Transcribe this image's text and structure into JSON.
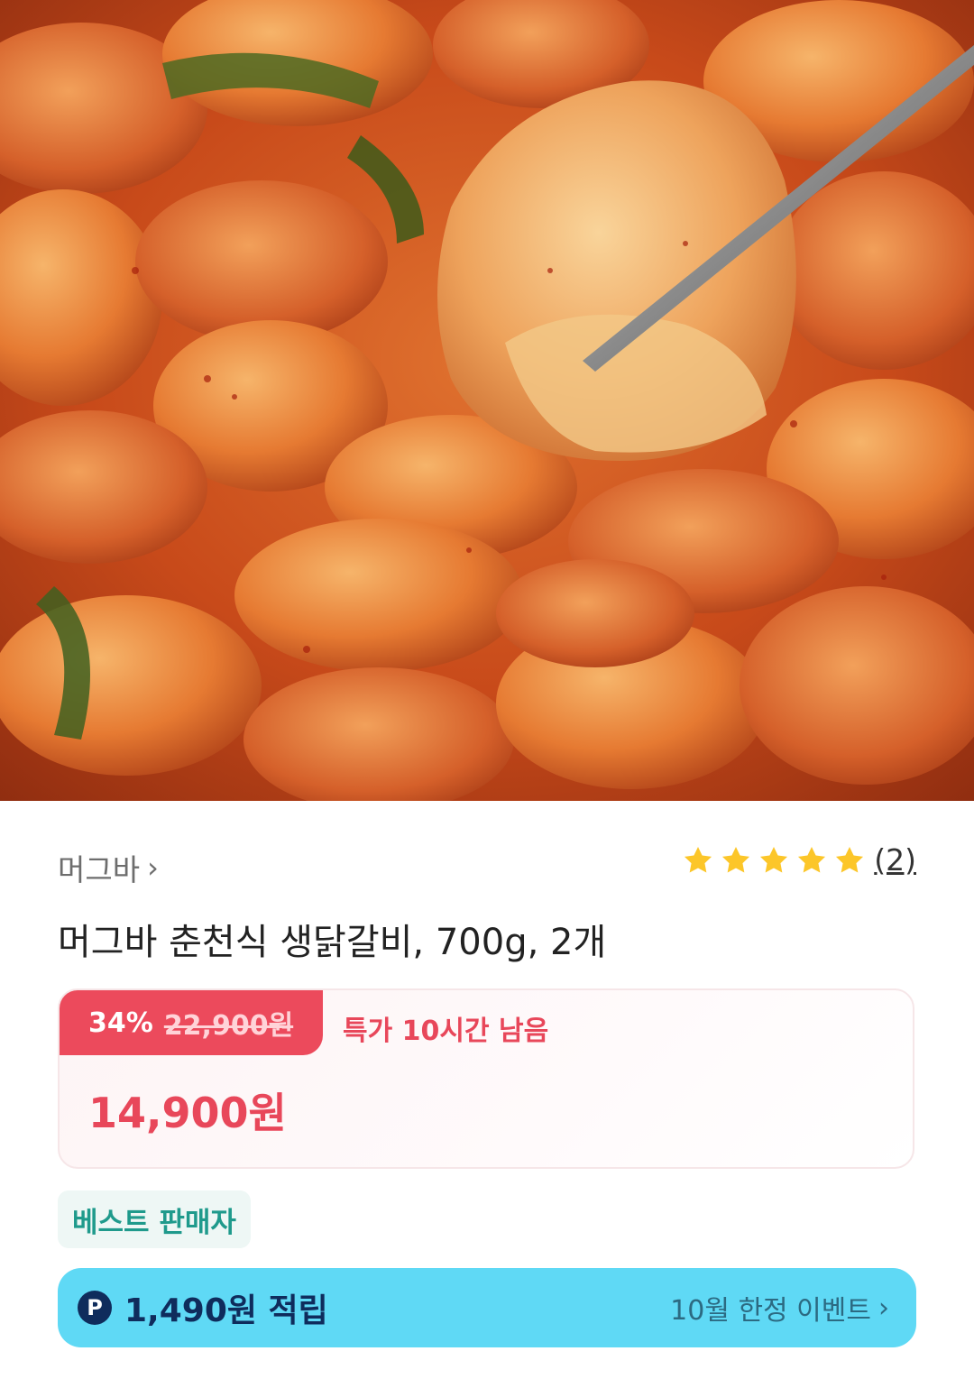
{
  "hero": {
    "alt_icon": "product-photo-spicy-chicken-galbi"
  },
  "product": {
    "brand": "머그바",
    "title": "머그바 춘천식 생닭갈비, 700g, 2개",
    "rating_stars": 5,
    "review_count": "(2)",
    "discount_rate": "34%",
    "original_price": "22,900원",
    "deal_timer": "특가 10시간 남음",
    "sale_price": "14,900원",
    "badge": "베스트 판매자"
  },
  "points": {
    "icon_letter": "P",
    "text": "1,490원 적립",
    "event_label": "10월 한정 이벤트"
  },
  "colors": {
    "accent_red": "#ec4a5c",
    "points_bar": "#5fd9f5",
    "badge_text": "#1f9a8c",
    "star": "#fcc629"
  }
}
